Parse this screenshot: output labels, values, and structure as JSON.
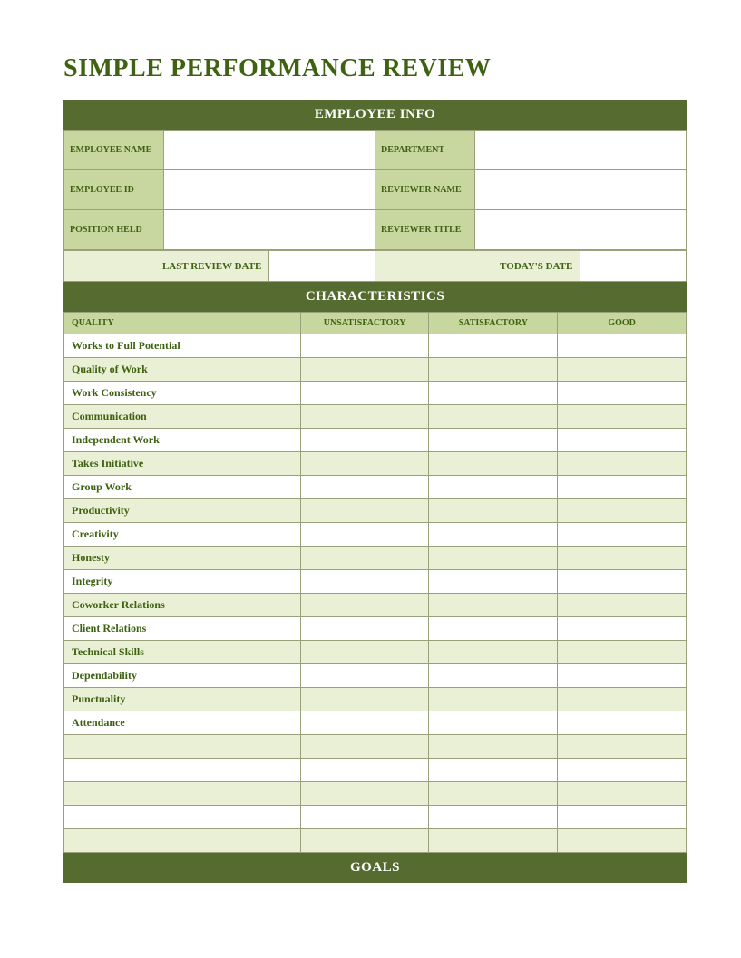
{
  "title": "SIMPLE PERFORMANCE REVIEW",
  "sections": {
    "employee_info": "EMPLOYEE INFO",
    "characteristics": "CHARACTERISTICS",
    "goals": "GOALS"
  },
  "info": {
    "labels": {
      "employee_name": "EMPLOYEE NAME",
      "department": "DEPARTMENT",
      "employee_id": "EMPLOYEE ID",
      "reviewer_name": "REVIEWER NAME",
      "position_held": "POSITION HELD",
      "reviewer_title": "REVIEWER TITLE"
    },
    "values": {
      "employee_name": "",
      "department": "",
      "employee_id": "",
      "reviewer_name": "",
      "position_held": "",
      "reviewer_title": ""
    }
  },
  "dates": {
    "labels": {
      "last_review": "LAST REVIEW DATE",
      "today": "TODAY'S DATE"
    },
    "values": {
      "last_review": "",
      "today": ""
    }
  },
  "char_headers": {
    "quality": "QUALITY",
    "unsatisfactory": "UNSATISFACTORY",
    "satisfactory": "SATISFACTORY",
    "good": "GOOD"
  },
  "char_rows": [
    {
      "name": "Works to Full Potential",
      "unsat": "",
      "sat": "",
      "good": ""
    },
    {
      "name": "Quality of Work",
      "unsat": "",
      "sat": "",
      "good": ""
    },
    {
      "name": "Work Consistency",
      "unsat": "",
      "sat": "",
      "good": ""
    },
    {
      "name": "Communication",
      "unsat": "",
      "sat": "",
      "good": ""
    },
    {
      "name": "Independent Work",
      "unsat": "",
      "sat": "",
      "good": ""
    },
    {
      "name": "Takes Initiative",
      "unsat": "",
      "sat": "",
      "good": ""
    },
    {
      "name": "Group Work",
      "unsat": "",
      "sat": "",
      "good": ""
    },
    {
      "name": "Productivity",
      "unsat": "",
      "sat": "",
      "good": ""
    },
    {
      "name": "Creativity",
      "unsat": "",
      "sat": "",
      "good": ""
    },
    {
      "name": "Honesty",
      "unsat": "",
      "sat": "",
      "good": ""
    },
    {
      "name": "Integrity",
      "unsat": "",
      "sat": "",
      "good": ""
    },
    {
      "name": "Coworker Relations",
      "unsat": "",
      "sat": "",
      "good": ""
    },
    {
      "name": "Client Relations",
      "unsat": "",
      "sat": "",
      "good": ""
    },
    {
      "name": "Technical Skills",
      "unsat": "",
      "sat": "",
      "good": ""
    },
    {
      "name": "Dependability",
      "unsat": "",
      "sat": "",
      "good": ""
    },
    {
      "name": "Punctuality",
      "unsat": "",
      "sat": "",
      "good": ""
    },
    {
      "name": "Attendance",
      "unsat": "",
      "sat": "",
      "good": ""
    },
    {
      "name": "",
      "unsat": "",
      "sat": "",
      "good": ""
    },
    {
      "name": "",
      "unsat": "",
      "sat": "",
      "good": ""
    },
    {
      "name": "",
      "unsat": "",
      "sat": "",
      "good": ""
    },
    {
      "name": "",
      "unsat": "",
      "sat": "",
      "good": ""
    },
    {
      "name": "",
      "unsat": "",
      "sat": "",
      "good": ""
    }
  ]
}
